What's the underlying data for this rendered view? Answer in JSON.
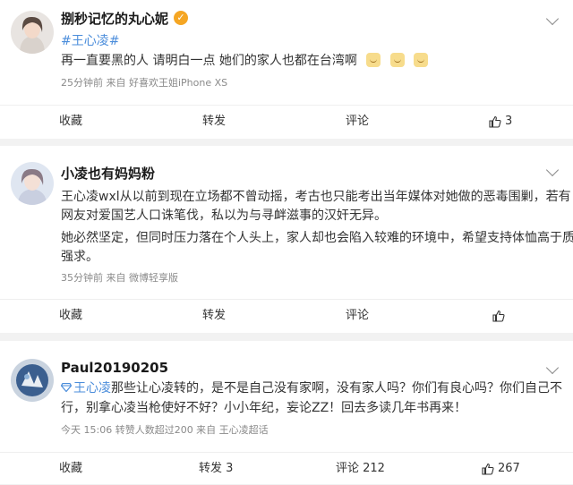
{
  "posts": [
    {
      "author": "捌秒记忆的丸心妮",
      "topic": "#王心凌#",
      "text": "再一直要黑的人 请明白一点 她们的家人也都在台湾啊",
      "emoji": "doge-emoji",
      "meta": "25分钟前   来自 好喜欢王姐iPhone XS",
      "actions": {
        "collect": "收藏",
        "repost": "转发",
        "comment": "评论",
        "like_count": "3"
      }
    },
    {
      "author": "小凌也有妈妈粉",
      "text_p1_l1": "王心凌wxl从以前到现在立场都不曾动摇，考古也只能考出当年媒体对她做的恶毒围剿，若有",
      "text_p1_l2": "网友对爱国艺人口诛笔伐，私以为与寻衅滋事的汉奸无异。",
      "text_p2_l1": "她必然坚定，但同时压力落在个人头上，家人却也会陷入较难的环境中，希望支持体恤高于质疑",
      "text_p2_l2": "强求。",
      "meta": "35分钟前   来自 微博轻享版",
      "actions": {
        "collect": "收藏",
        "repost": "转发",
        "comment": "评论",
        "like_count": ""
      }
    },
    {
      "author": "Paul20190205",
      "topic": "王心凌",
      "text_l1_rest": "那些让心凌转的，是不是自己没有家啊，没有家人吗？你们有良心吗？你们自己不",
      "text_l2": "行，别拿心凌当枪使好不好？小小年纪，妄论ZZ！回去多读几年书再来！",
      "meta": "今天 15:06 转赞人数超过200   来自 王心凌超话",
      "actions": {
        "collect": "收藏",
        "repost": "转发 3",
        "comment": "评论 212",
        "like_count": "267"
      }
    }
  ],
  "colors": {
    "link": "#4b8ddb",
    "meta": "#8a8a8a",
    "badge": "#f5a623"
  }
}
